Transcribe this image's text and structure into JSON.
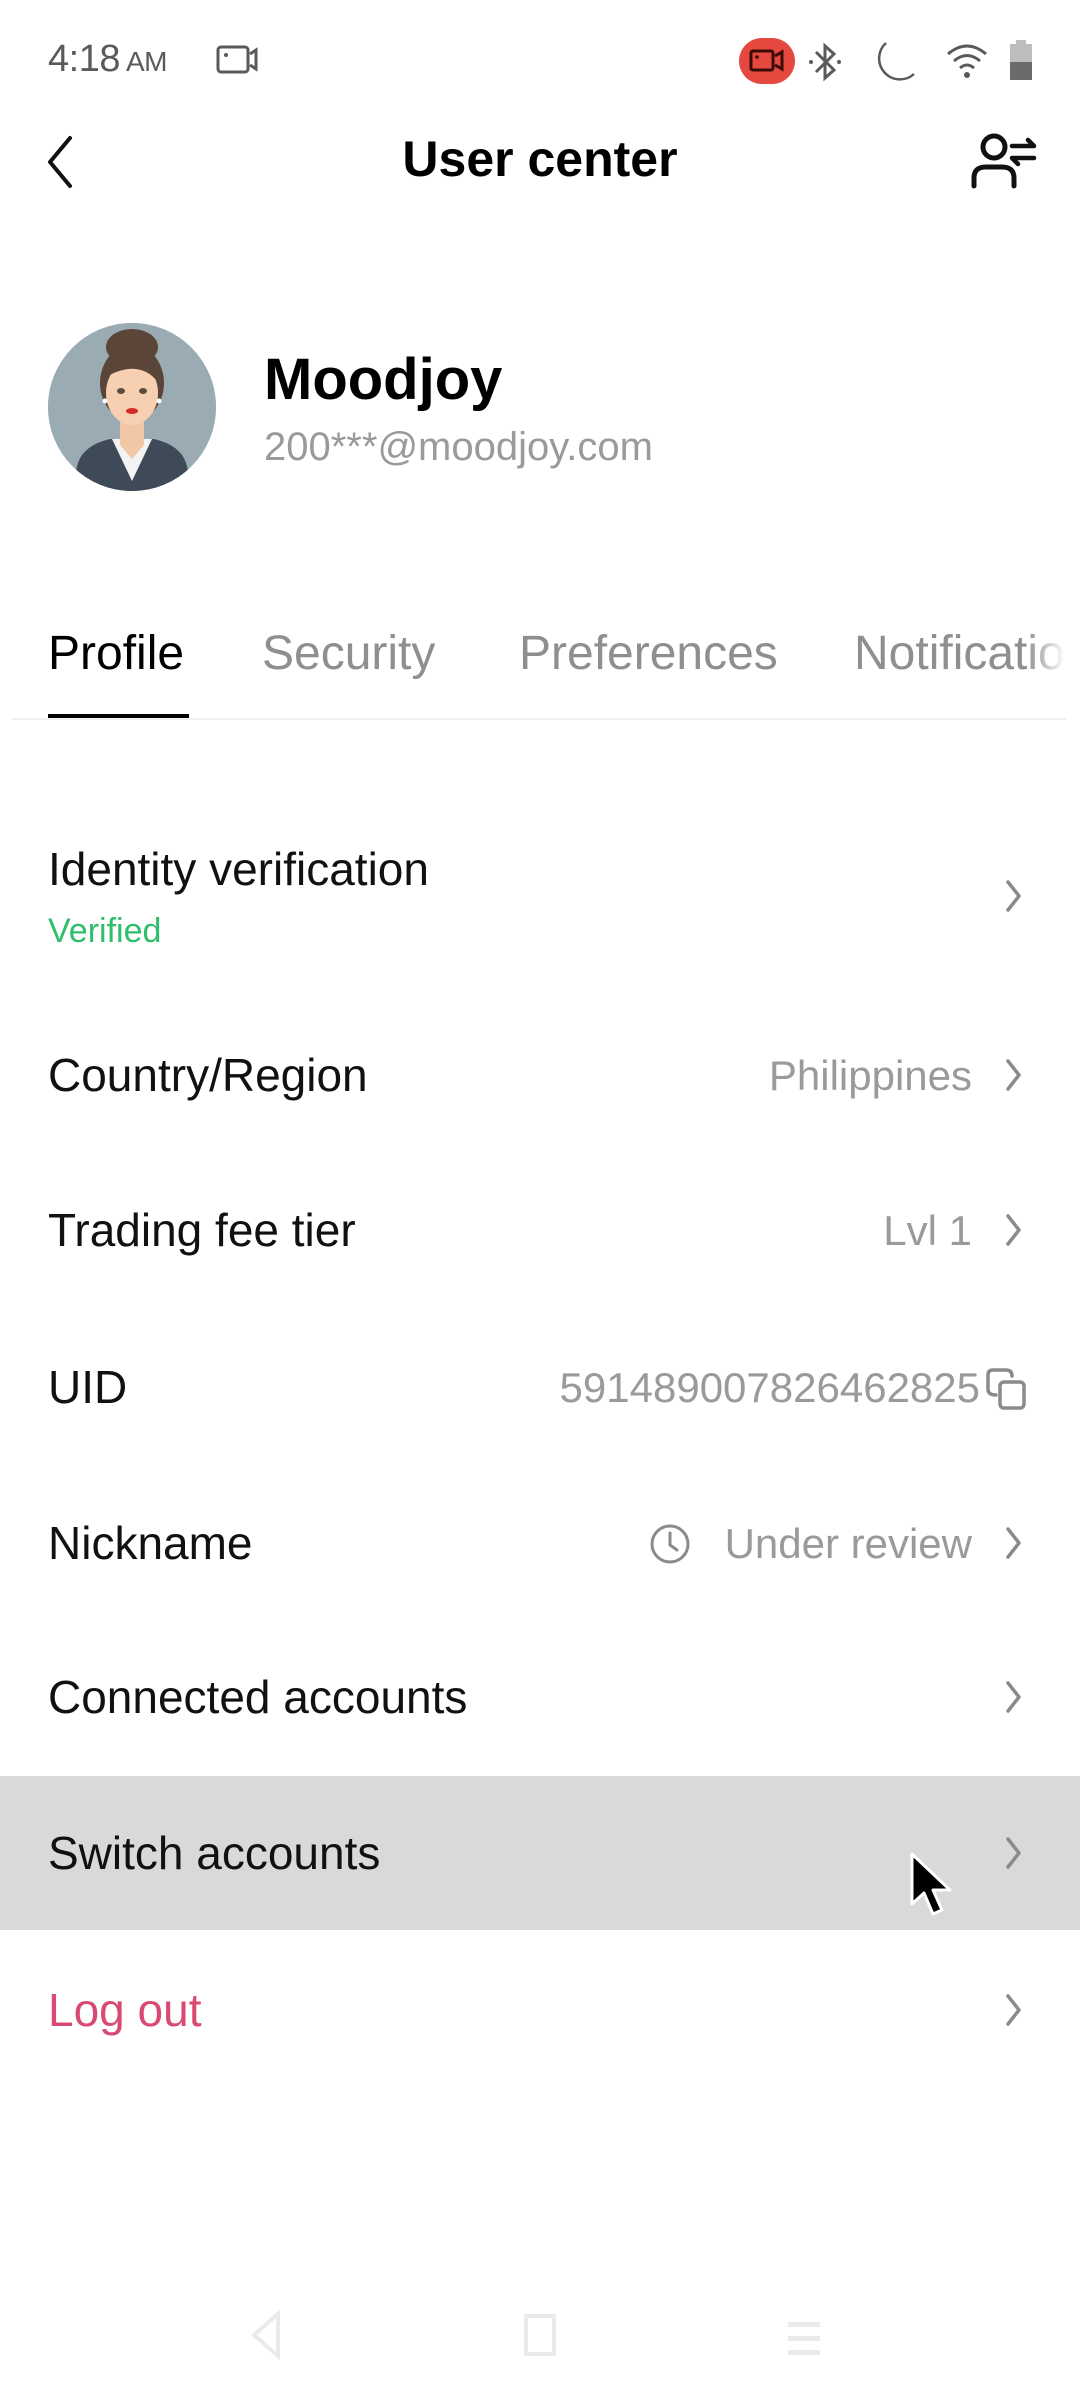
{
  "status_bar": {
    "time": "4:18",
    "ampm": "AM",
    "icons": [
      "screen-record-icon",
      "recording-indicator-icon",
      "bluetooth-icon",
      "do-not-disturb-moon-icon",
      "wifi-icon",
      "battery-icon"
    ]
  },
  "header": {
    "title": "User center",
    "back_icon": "chevron-left-icon",
    "switch_user_icon": "user-switch-icon"
  },
  "profile": {
    "name": "Moodjoy",
    "email": "200***@moodjoy.com"
  },
  "tabs": [
    {
      "label": "Profile",
      "active": true
    },
    {
      "label": "Security",
      "active": false
    },
    {
      "label": "Preferences",
      "active": false
    },
    {
      "label": "Notifications",
      "active": false
    }
  ],
  "rows": {
    "identity": {
      "label": "Identity verification",
      "status": "Verified"
    },
    "country": {
      "label": "Country/Region",
      "value": "Philippines"
    },
    "fee_tier": {
      "label": "Trading fee tier",
      "value": "Lvl 1"
    },
    "uid": {
      "label": "UID",
      "value": "591489007826462825"
    },
    "nickname": {
      "label": "Nickname",
      "value": "Under review"
    },
    "connected": {
      "label": "Connected accounts"
    },
    "switch": {
      "label": "Switch accounts"
    },
    "logout": {
      "label": "Log out"
    }
  },
  "colors": {
    "verified": "#2fbf6a",
    "logout": "#d94a72",
    "highlight": "#d9d9d9",
    "recording_badge": "#e5483f"
  }
}
